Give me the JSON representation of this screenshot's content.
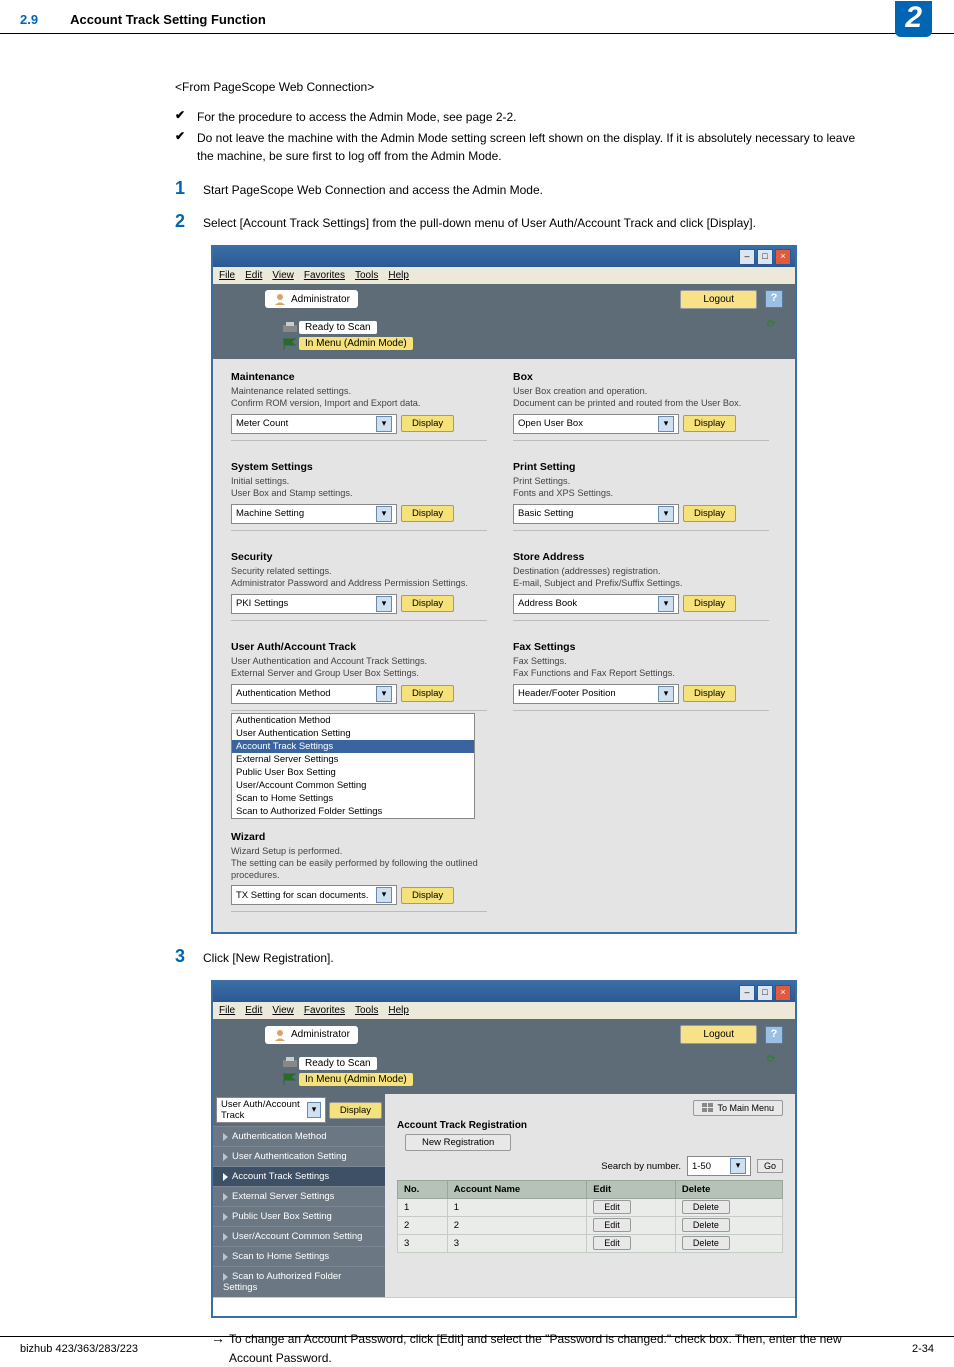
{
  "header": {
    "section": "2.9",
    "title": "Account Track Setting Function",
    "chapter": "2"
  },
  "intro": "<From PageScope Web Connection>",
  "checks": [
    "For the procedure to access the Admin Mode, see page 2-2.",
    "Do not leave the machine with the Admin Mode setting screen left shown on the display. If it is absolutely necessary to leave the machine, be sure first to log off from the Admin Mode."
  ],
  "steps": [
    "Start PageScope Web Connection and access the Admin Mode.",
    "Select [Account Track Settings] from the pull-down menu of User Auth/Account Track and click [Display].",
    "Click [New Registration]."
  ],
  "note": "To change an Account Password, click [Edit] and select the \"Password is changed.\" check box. Then, enter the new Account Password.",
  "ss1": {
    "menubar": [
      "File",
      "Edit",
      "View",
      "Favorites",
      "Tools",
      "Help"
    ],
    "admin": "Administrator",
    "logout": "Logout",
    "status": [
      "Ready to Scan",
      "In Menu (Admin Mode)"
    ],
    "cards": [
      {
        "t": "Maintenance",
        "d": "Maintenance related settings.\nConfirm ROM version, Import and Export data.",
        "s": "Meter Count"
      },
      {
        "t": "Box",
        "d": "User Box creation and operation.\nDocument can be printed and routed from the User Box.",
        "s": "Open User Box"
      },
      {
        "t": "System Settings",
        "d": "Initial settings.\nUser Box and Stamp settings.",
        "s": "Machine Setting"
      },
      {
        "t": "Print Setting",
        "d": "Print Settings.\nFonts and XPS Settings.",
        "s": "Basic Setting"
      },
      {
        "t": "Security",
        "d": "Security related settings.\nAdministrator Password and Address Permission Settings.",
        "s": "PKI Settings"
      },
      {
        "t": "Store Address",
        "d": "Destination (addresses) registration.\nE-mail, Subject and Prefix/Suffix Settings.",
        "s": "Address Book"
      },
      {
        "t": "User Auth/Account Track",
        "d": "User Authentication and Account Track Settings.\nExternal Server and Group User Box Settings.",
        "s": "Authentication Method",
        "drop": [
          "Authentication Method",
          "User Authentication Setting",
          "Account Track Settings",
          "External Server Settings",
          "Public User Box Setting",
          "User/Account Common Setting",
          "Scan to Home Settings",
          "Scan to Authorized Folder Settings"
        ],
        "hi": 2
      },
      {
        "t": "Fax Settings",
        "d": "Fax Settings.\nFax Functions and Fax Report Settings.",
        "s": "Header/Footer Position"
      },
      {
        "t": "Wizard",
        "d": "Wizard Setup is performed.\nThe setting can be easily performed by following the outlined procedures.",
        "s": "TX Setting for scan documents."
      }
    ],
    "display": "Display"
  },
  "ss2": {
    "navsel": "User Auth/Account Track",
    "display": "Display",
    "tomain": "To Main Menu",
    "items": [
      "Authentication Method",
      "User Authentication Setting",
      "Account Track Settings",
      "External Server Settings",
      "Public User Box Setting",
      "User/Account Common Setting",
      "Scan to Home Settings",
      "Scan to Authorized Folder Settings"
    ],
    "active": 2,
    "panelTitle": "Account Track Registration",
    "newreg": "New Registration",
    "search": "Search by number.",
    "range": "1-50",
    "go": "Go",
    "cols": [
      "No.",
      "Account Name",
      "Edit",
      "Delete"
    ],
    "rows": [
      [
        "1",
        "1"
      ],
      [
        "2",
        "2"
      ],
      [
        "3",
        "3"
      ]
    ],
    "edit": "Edit",
    "del": "Delete"
  },
  "footer": {
    "left": "bizhub 423/363/283/223",
    "right": "2-34"
  }
}
